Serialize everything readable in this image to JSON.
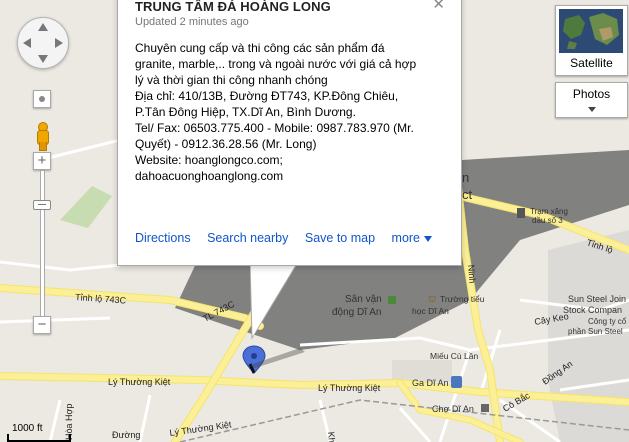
{
  "infowindow": {
    "title": "TRUNG TÂM ĐÁ HOÀNG LONG",
    "updated": "Updated 2 minutes ago",
    "description_lines": [
      "Chuyên cung cấp và thi công các sản phẩm đá",
      "granite, marble,.. trong và ngoài nước với giá cả hợp",
      "lý và thời gian thi công nhanh chóng",
      "Địa chỉ: 410/13B, Đường ĐT743, KP.Đông Chiêu,",
      "P.Tân Đông Hiệp, TX.Dĩ An, Bình Dương.",
      "Tel/ Fax: 06503.775.400 - Mobile: 0987.783.970 (Mr.",
      "Quyết) - 0912.36.28.56 (Mr. Long)",
      "Website: hoanglongco.com;",
      "dahoacuonghoanglong.com"
    ],
    "links": {
      "directions": "Directions",
      "search_nearby": "Search nearby",
      "save_to_map": "Save to map",
      "more": "more"
    },
    "close_icon": "close-icon"
  },
  "controls": {
    "satellite_label": "Satellite",
    "photos_label": "Photos",
    "zoom_in": "+",
    "zoom_out": "−"
  },
  "scale": "1000 ft",
  "map_labels": {
    "place_a": "n",
    "place_b": "ct",
    "gas_station_1": "Trạm xăng",
    "gas_station_2": "dầu số 3",
    "road_tinh_ho_1": "Tỉnh lộ",
    "road_ninh": "Ninh",
    "sun_steel_1": "Sun Steel Join",
    "sun_steel_2": "Stock Compan",
    "sun_steel_3": "Công ty cổ",
    "sun_steel_4": "phần Sun Steel",
    "tinh_lo_743c": "Tỉnh lộ 743C",
    "tl_743c": "TL 743C",
    "san_van_dong_1": "Sân vận",
    "san_van_dong_2": "động Dĩ An",
    "truong_1": "Trường tiểu",
    "truong_2": "học Dĩ An",
    "cay_keo": "Cây Keo",
    "mieu_cu_lan": "Miếu Cù Lần",
    "dong_an": "Đồng An",
    "ly_thuong_kiet_1": "Lý Thường Kiệt",
    "ly_thuong_kiet_2": "Lý Thường Kiệt",
    "ga_di_an": "Ga Dĩ An",
    "cho_di_an": "Chợ Dĩ An",
    "co_bac": "Cô Bắc",
    "hoa_hop": "Hòa Hợp",
    "duong": "Đường",
    "khu": "Khu 5",
    "ly_thuong_kiet_top": "Lý Thường Kiệt"
  }
}
